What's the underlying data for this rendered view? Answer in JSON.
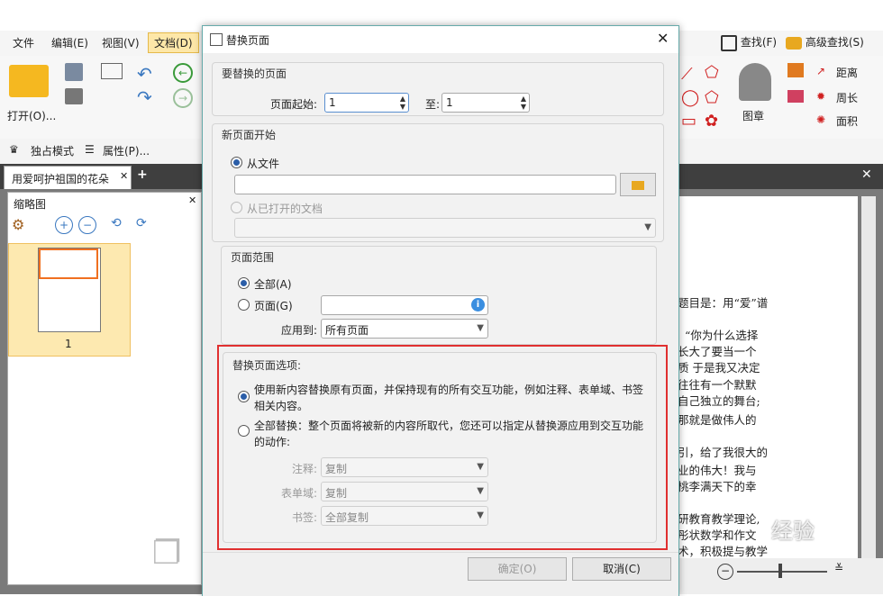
{
  "menubar": {
    "items": [
      "文件",
      "编辑(E)",
      "视图(V)",
      "文档(D)"
    ]
  },
  "ribbon": {
    "open_label": "打开(O)...",
    "stamp_label": "图章",
    "distance_label": "距离",
    "perimeter_label": "周长",
    "area_label": "面积",
    "find_label": "查找(F)",
    "adv_find_label": "高级查找(S)",
    "exclusive_label": "独占模式",
    "properties_label": "属性(P)..."
  },
  "doc_tab": {
    "title": "用爱呵护祖国的花朵"
  },
  "thumbnail_panel": {
    "title": "缩略图",
    "page_number": "1"
  },
  "doc_text": [
    "题目是：用“爱”谱",
    "“你为什么选择",
    "长大了要当一个",
    "质  于是我又决定",
    "往往有一个默默",
    "自己独立的舞台;",
    "那就是做伟人的",
    "引，给了我很大的",
    "业的伟大！我与",
    "桃李满天下的幸",
    "研教育教学理论,",
    "彤状数学和作文",
    "术，积极提与教学"
  ],
  "watermark": "经验",
  "dialog": {
    "title": "替换页面",
    "pages_to_replace": {
      "title": "要替换的页面",
      "start_label": "页面起始:",
      "start_value": "1",
      "to_label": "至:",
      "to_value": "1"
    },
    "new_page_start": {
      "title": "新页面开始",
      "from_file_label": "从文件",
      "file_path": "",
      "from_open_label": "从已打开的文档",
      "open_doc_value": ""
    },
    "page_range": {
      "title": "页面范围",
      "all_label": "全部(A)",
      "pages_label": "页面(G)",
      "pages_value": "",
      "apply_to_label": "应用到:",
      "apply_to_value": "所有页面"
    },
    "replace_options": {
      "title": "替换页面选项:",
      "option1_line1": "使用新内容替换原有页面，并保持现有的所有交互功能，例如注释、表单域、书签",
      "option1_line2": "相关内容。",
      "option2_line1": "全部替换：整个页面将被新的内容所取代，您还可以指定从替换源应用到交互功能",
      "option2_line2": "的动作:",
      "annot_label": "注释:",
      "annot_value": "复制",
      "form_label": "表单域:",
      "form_value": "复制",
      "bookmark_label": "书签:",
      "bookmark_value": "全部复制"
    },
    "ok_label": "确定(O)",
    "cancel_label": "取消(C)"
  },
  "colors": {
    "highlight_border": "#e03030",
    "accent": "#2b5ea8"
  }
}
